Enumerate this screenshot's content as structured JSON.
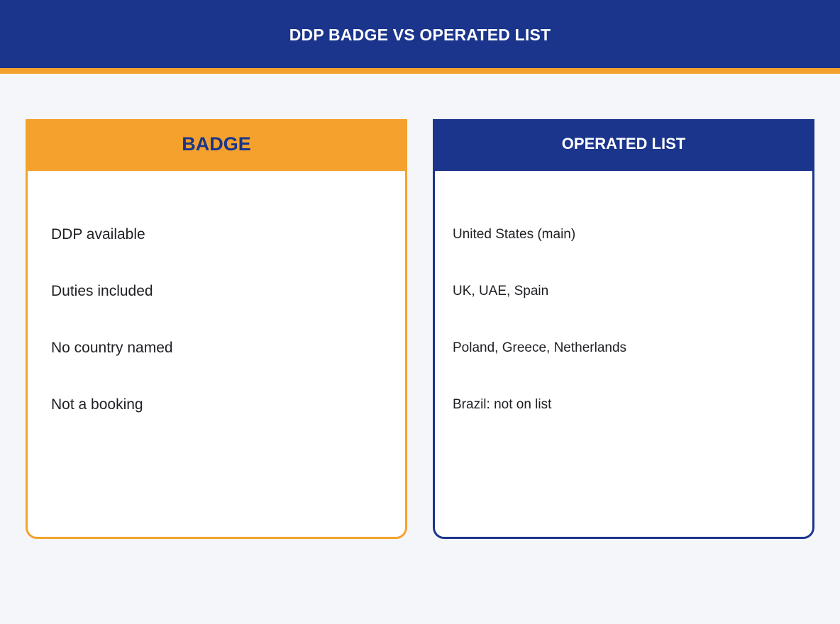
{
  "header": {
    "title": "DDP BADGE VS OPERATED LIST"
  },
  "badge_card": {
    "title": "BADGE",
    "items": [
      "DDP available",
      "Duties included",
      "No country named",
      "Not a booking"
    ]
  },
  "operated_card": {
    "title": "OPERATED LIST",
    "items": [
      "United States (main)",
      "UK, UAE, Spain",
      "Poland, Greece, Netherlands",
      "Brazil: not on list"
    ]
  },
  "colors": {
    "navy": "#1b358c",
    "orange": "#f4a22d",
    "background": "#f5f6f9"
  }
}
